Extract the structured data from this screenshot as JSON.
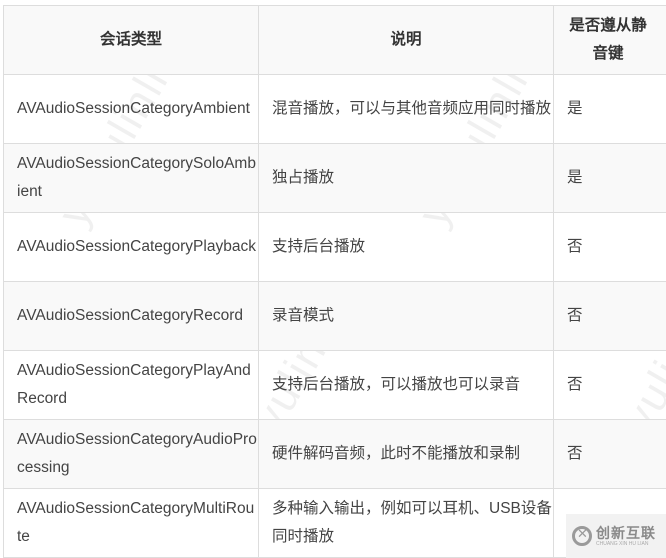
{
  "table": {
    "headers": {
      "type": "会话类型",
      "description": "说明",
      "mute_line1": "是否遵从静",
      "mute_line2": "音键"
    },
    "rows": [
      {
        "type": "AVAudioSessionCategoryAmbient",
        "description": "混音播放，可以与其他音频应用同时播放",
        "mute": "是"
      },
      {
        "type": "AVAudioSessionCategorySoloAmbient",
        "description": "独占播放",
        "mute": "是"
      },
      {
        "type": "AVAudioSessionCategoryPlayback",
        "description": "支持后台播放",
        "mute": "否"
      },
      {
        "type": "AVAudioSessionCategoryRecord",
        "description": "录音模式",
        "mute": "否"
      },
      {
        "type": "AVAudioSessionCategoryPlayAndRecord",
        "description": "支持后台播放，可以播放也可以录音",
        "mute": "否"
      },
      {
        "type": "AVAudioSessionCategoryAudioProcessing",
        "description": "硬件解码音频，此时不能播放和录制",
        "mute": "否"
      },
      {
        "type": "AVAudioSessionCategoryMultiRoute",
        "description": "多种输入输出，例如可以耳机、USB设备同时播放",
        "mute": ""
      }
    ]
  },
  "watermark": {
    "text": "y_yulinlin"
  },
  "logo": {
    "icon": "chuangxin-logo-icon",
    "name_cn": "创新互联",
    "name_en": "CHUANG XIN HU LIAN"
  }
}
